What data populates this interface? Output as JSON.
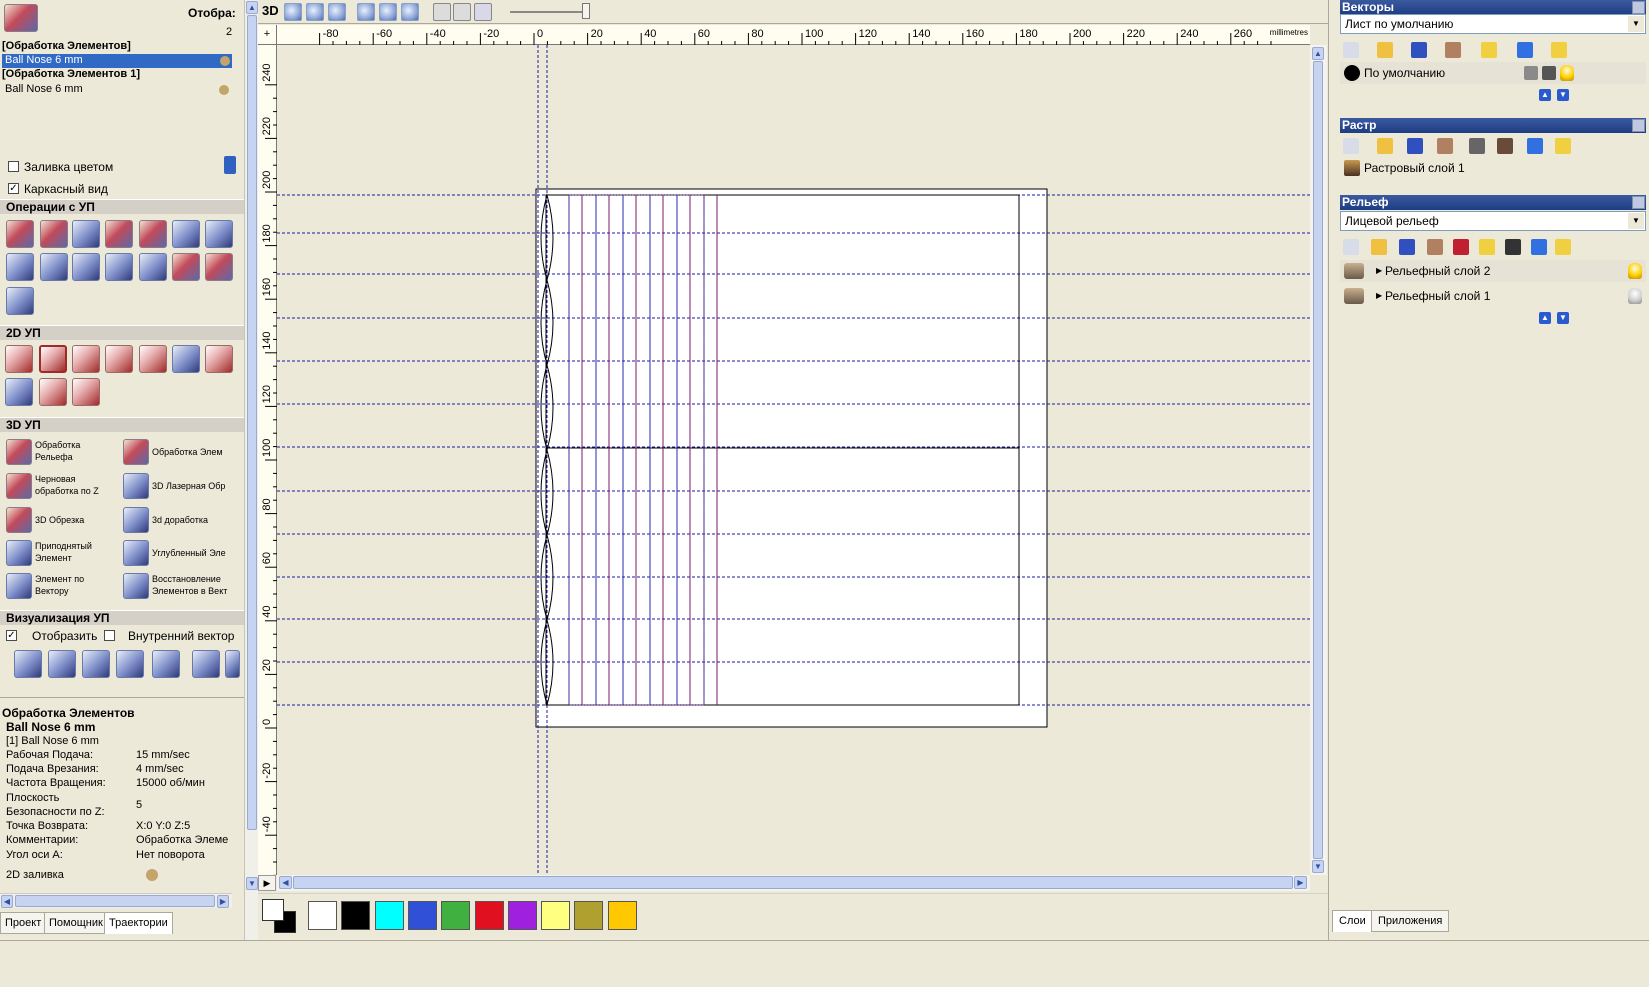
{
  "left_panel": {
    "header_title": "Отобра:",
    "header_num": "2",
    "toolpath_list": [
      {
        "title": "[Обработка Элементов]",
        "tool": "Ball Nose 6 mm",
        "selected": true
      },
      {
        "title": "[Обработка Элементов 1]",
        "tool": "Ball Nose 6 mm",
        "selected": false
      }
    ],
    "fill_color_label": "Заливка цветом",
    "wireframe_label": "Каркасный вид",
    "ops_section": "Операции с УП",
    "section_2d": "2D УП",
    "section_3d": "3D УП",
    "ops_3d": [
      {
        "label": "Обработка Рельефа"
      },
      {
        "label": "Обработка Элем"
      },
      {
        "label": "Черновая обработка по Z"
      },
      {
        "label": "3D Лазерная Обр"
      },
      {
        "label": "3D Обрезка"
      },
      {
        "label": "3d доработка"
      },
      {
        "label": "Приподнятый Элемент"
      },
      {
        "label": "Углубленный Эле"
      },
      {
        "label": "Элемент по Вектору"
      },
      {
        "label": "Восстановление Элементов в Вект"
      }
    ],
    "vis_section": "Визуализация УП",
    "show_label": "Отобразить",
    "inner_vector_label": "Внутренний вектор",
    "props_title": "Обработка Элементов",
    "props_tool": "Ball Nose 6 mm",
    "props": [
      {
        "k": "[1] Ball Nose 6 mm",
        "v": ""
      },
      {
        "k": "Рабочая Подача:",
        "v": "15 mm/sec"
      },
      {
        "k": "Подача Врезания:",
        "v": "4 mm/sec"
      },
      {
        "k": "Частота Вращения:",
        "v": "15000 об/мин"
      },
      {
        "k": "Плоскость",
        "v": "5"
      },
      {
        "k": "Безопасности по Z:",
        "v": ""
      },
      {
        "k": "Точка Возврата:",
        "v": "X:0 Y:0 Z:5"
      },
      {
        "k": "Комментарии:",
        "v": "Обработка Элеме"
      },
      {
        "k": "Угол оси A:",
        "v": "Нет поворота"
      }
    ],
    "fill_2d_label": "2D заливка",
    "tabs": [
      "Проект",
      "Помощник",
      "Траектории"
    ]
  },
  "toolbar": {
    "mode_3d": "3D"
  },
  "ruler": {
    "units": "millimetres",
    "x_labels": [
      "-80",
      "-60",
      "-40",
      "-20",
      "0",
      "20",
      "40",
      "60",
      "80",
      "100",
      "120",
      "140",
      "160",
      "180",
      "200",
      "220",
      "240",
      "260"
    ],
    "y_labels": [
      "240",
      "220",
      "200",
      "180",
      "160",
      "140",
      "120",
      "100",
      "80",
      "60",
      "40",
      "20",
      "0",
      "-20",
      "-40"
    ]
  },
  "palette": {
    "colors": [
      "#ffffff",
      "#000000",
      "#00ffff",
      "#3050d8",
      "#40b040",
      "#e01020",
      "#a020e0",
      "#ffff80",
      "#b0a030",
      "#ffc800"
    ]
  },
  "right_panel": {
    "vectors_title": "Векторы",
    "vectors_select": "Лист по умолчанию",
    "vectors_layer": "По умолчанию",
    "raster_title": "Растр",
    "raster_layer": "Растровый слой 1",
    "relief_title": "Рельеф",
    "relief_select": "Лицевой рельеф",
    "relief_layers": [
      "Рельефный слой 2",
      "Рельефный слой 1"
    ],
    "tabs": [
      "Слои",
      "Приложения"
    ]
  }
}
